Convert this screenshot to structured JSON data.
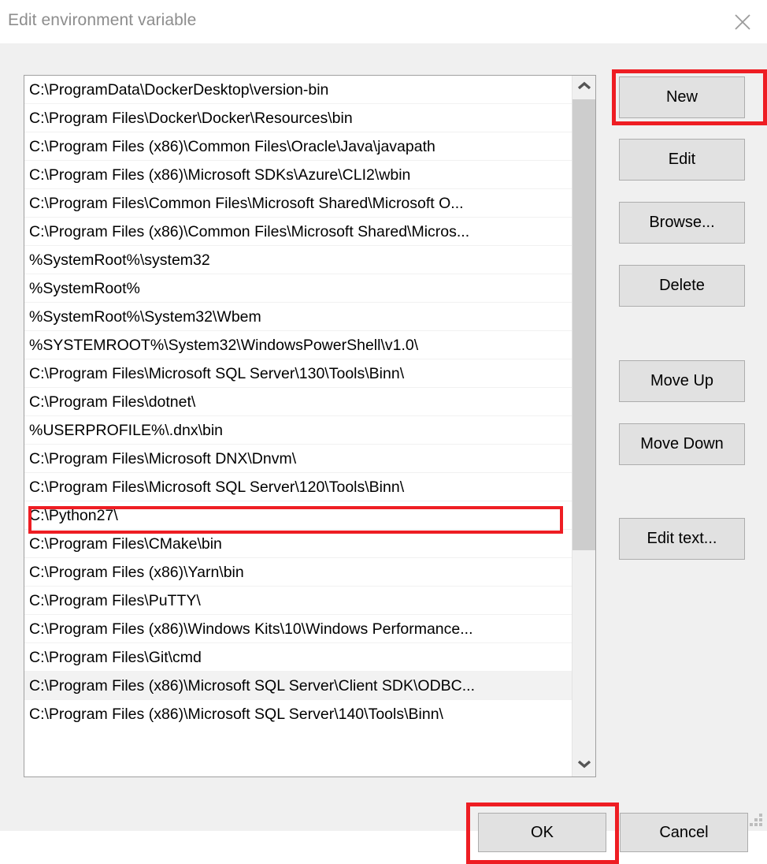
{
  "window": {
    "title": "Edit environment variable",
    "close_icon": "close-icon"
  },
  "list": {
    "items": [
      "C:\\ProgramData\\DockerDesktop\\version-bin",
      "C:\\Program Files\\Docker\\Docker\\Resources\\bin",
      "C:\\Program Files (x86)\\Common Files\\Oracle\\Java\\javapath",
      "C:\\Program Files (x86)\\Microsoft SDKs\\Azure\\CLI2\\wbin",
      "C:\\Program Files\\Common Files\\Microsoft Shared\\Microsoft O...",
      "C:\\Program Files (x86)\\Common Files\\Microsoft Shared\\Micros...",
      "%SystemRoot%\\system32",
      "%SystemRoot%",
      "%SystemRoot%\\System32\\Wbem",
      "%SYSTEMROOT%\\System32\\WindowsPowerShell\\v1.0\\",
      "C:\\Program Files\\Microsoft SQL Server\\130\\Tools\\Binn\\",
      "C:\\Program Files\\dotnet\\",
      "%USERPROFILE%\\.dnx\\bin",
      "C:\\Program Files\\Microsoft DNX\\Dnvm\\",
      "C:\\Program Files\\Microsoft SQL Server\\120\\Tools\\Binn\\",
      "C:\\Python27\\",
      "C:\\Program Files\\CMake\\bin",
      "C:\\Program Files (x86)\\Yarn\\bin",
      "C:\\Program Files\\PuTTY\\",
      "C:\\Program Files (x86)\\Windows Kits\\10\\Windows Performance...",
      "C:\\Program Files\\Git\\cmd",
      "C:\\Program Files (x86)\\Microsoft SQL Server\\Client SDK\\ODBC...",
      "C:\\Program Files (x86)\\Microsoft SQL Server\\140\\Tools\\Binn\\"
    ],
    "selected_index": 21,
    "annotated_index": 15
  },
  "scrollbar": {
    "up_icon": "chevron-up-icon",
    "down_icon": "chevron-down-icon"
  },
  "side_buttons": {
    "new": "New",
    "edit": "Edit",
    "browse": "Browse...",
    "delete": "Delete",
    "move_up": "Move Up",
    "move_down": "Move Down",
    "edit_text": "Edit text..."
  },
  "bottom_buttons": {
    "ok": "OK",
    "cancel": "Cancel"
  },
  "annotations": {
    "color": "#ee1d23",
    "targets": [
      "new-button",
      "ok-button",
      "list-row-python27"
    ]
  },
  "colors": {
    "dialog_background": "#f0f0f0",
    "titlebar_background": "#ffffff",
    "title_text": "#8d8d8d",
    "button_face": "#e1e1e1",
    "button_border": "#adadad",
    "list_background": "#ffffff",
    "selected_row": "#f2f2f2",
    "scrollbar_thumb": "#cdcdcd",
    "annotation_red": "#ee1d23"
  }
}
